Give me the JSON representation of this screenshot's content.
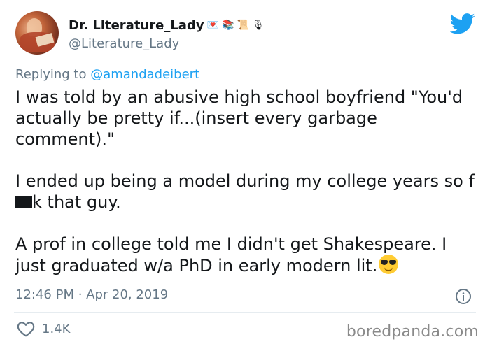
{
  "user": {
    "display_name": "Dr. Literature_Lady",
    "handle": "@Literature_Lady",
    "name_emojis": [
      "💌",
      "📚",
      "📜",
      "🎙"
    ]
  },
  "reply": {
    "prefix": "Replying to ",
    "mention": "@amandadeibert"
  },
  "tweet": {
    "p1": "I was told by an abusive high school boyfriend \"You'd actually be pretty if...(insert every garbage comment).\"",
    "p2_start": "I ended up being a model during my college years so f",
    "p2_end": "k that guy.",
    "p3": "A prof in college told me I didn't get Shakespeare. I just graduated w/a PhD in early modern lit."
  },
  "meta": {
    "timestamp": "12:46 PM · Apr 20, 2019"
  },
  "actions": {
    "like_count": "1.4K"
  },
  "watermark": "boredpanda.com",
  "colors": {
    "twitter_blue": "#1da1f2",
    "secondary_text": "#657786",
    "primary_text": "#14171a"
  },
  "icons": [
    "twitter-bird-icon",
    "info-icon",
    "heart-icon",
    "sunglasses-emoji-icon"
  ]
}
